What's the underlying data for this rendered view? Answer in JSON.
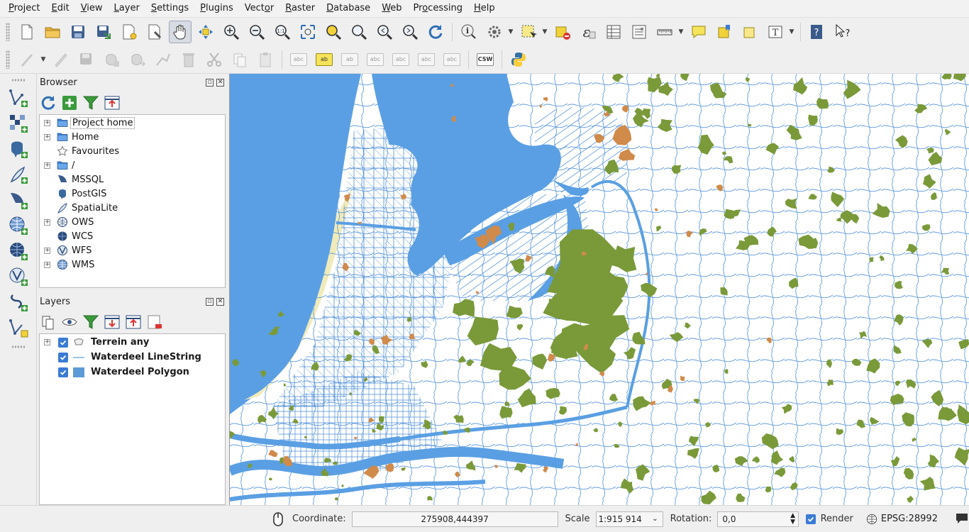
{
  "menu": [
    {
      "label": "Project",
      "u": "P",
      "rest": "roject"
    },
    {
      "label": "Edit",
      "u": "E",
      "rest": "dit"
    },
    {
      "label": "View",
      "u": "V",
      "rest": "iew"
    },
    {
      "label": "Layer",
      "u": "L",
      "rest": "ayer"
    },
    {
      "label": "Settings",
      "u": "S",
      "rest": "ettings"
    },
    {
      "label": "Plugins",
      "u": "P",
      "rest": "lugins"
    },
    {
      "label": "Vector",
      "u": "o",
      "rest": "Vect|r"
    },
    {
      "label": "Raster",
      "u": "R",
      "rest": "aster"
    },
    {
      "label": "Database",
      "u": "D",
      "rest": "atabase"
    },
    {
      "label": "Web",
      "u": "W",
      "rest": "eb"
    },
    {
      "label": "Processing",
      "u": "o",
      "rest": "Pr|cessing"
    },
    {
      "label": "Help",
      "u": "H",
      "rest": "elp"
    }
  ],
  "browser": {
    "title": "Browser",
    "items": [
      {
        "label": "Project home",
        "icon": "folder-icon",
        "expandable": true,
        "selected": true
      },
      {
        "label": "Home",
        "icon": "folder-icon",
        "expandable": true
      },
      {
        "label": "Favourites",
        "icon": "star-icon",
        "expandable": false
      },
      {
        "label": "/",
        "icon": "folder-icon",
        "expandable": true
      },
      {
        "label": "MSSQL",
        "icon": "mssql-icon",
        "expandable": false
      },
      {
        "label": "PostGIS",
        "icon": "postgis-icon",
        "expandable": false
      },
      {
        "label": "SpatiaLite",
        "icon": "spatialite-icon",
        "expandable": false
      },
      {
        "label": "OWS",
        "icon": "ows-icon",
        "expandable": true
      },
      {
        "label": "WCS",
        "icon": "wcs-icon",
        "expandable": false
      },
      {
        "label": "WFS",
        "icon": "wfs-icon",
        "expandable": true
      },
      {
        "label": "WMS",
        "icon": "wms-icon",
        "expandable": true
      }
    ]
  },
  "layers": {
    "title": "Layers",
    "items": [
      {
        "label": "Terrein any",
        "symbol": "polygon-group",
        "checked": true,
        "expandable": true
      },
      {
        "label": "Waterdeel LineString",
        "symbol": "line",
        "color": "#5b9bd5",
        "checked": true,
        "expandable": false
      },
      {
        "label": "Waterdeel Polygon",
        "symbol": "fill",
        "color": "#5b9bd5",
        "checked": true,
        "expandable": false
      }
    ]
  },
  "map": {
    "colors": {
      "water": "#5a9fe3",
      "forest": "#7a9a3a",
      "urban": "#d08a4a",
      "sand": "#f0ebba",
      "line": "#4f8fd8"
    }
  },
  "status": {
    "coordinate_label": "Coordinate:",
    "coordinate_value": "275908,444397",
    "scale_label": "Scale",
    "scale_value": "1:915 914",
    "rotation_label": "Rotation:",
    "rotation_value": "0,0",
    "render_label": "Render",
    "render_checked": true,
    "crs_label": "EPSG:28992"
  }
}
